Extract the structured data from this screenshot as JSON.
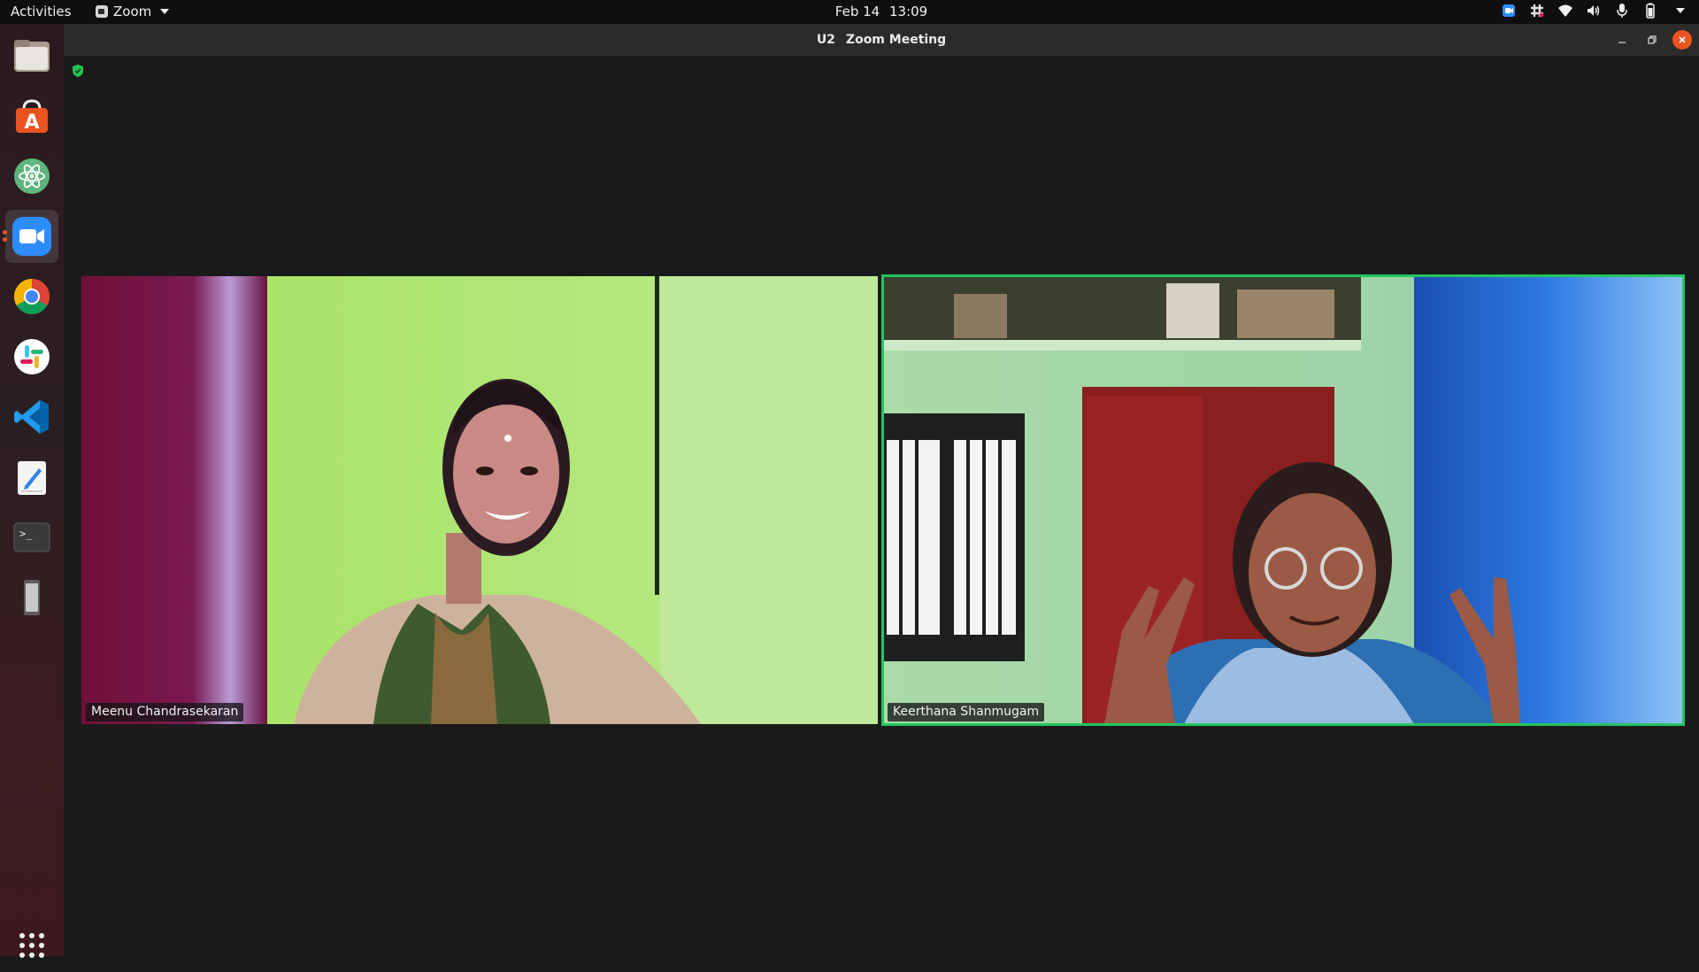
{
  "topbar": {
    "activities": "Activities",
    "app_name": "Zoom",
    "date": "Feb 14",
    "time": "13:09"
  },
  "window": {
    "title_prefix": "U2",
    "title": "Zoom Meeting"
  },
  "dock": {
    "items": [
      "files",
      "ubuntu-software",
      "atom",
      "zoom",
      "chrome",
      "slack",
      "vscode",
      "text-editor",
      "terminal",
      "removable-drive",
      "show-applications"
    ]
  },
  "participants": [
    {
      "name": "Meenu Chandrasekaran",
      "active_speaker": false
    },
    {
      "name": "Keerthana Shanmugam",
      "active_speaker": true
    }
  ],
  "colors": {
    "accent_speaker": "#22c55e",
    "ubuntu_orange": "#e95420",
    "zoom_blue": "#2d8cff"
  }
}
